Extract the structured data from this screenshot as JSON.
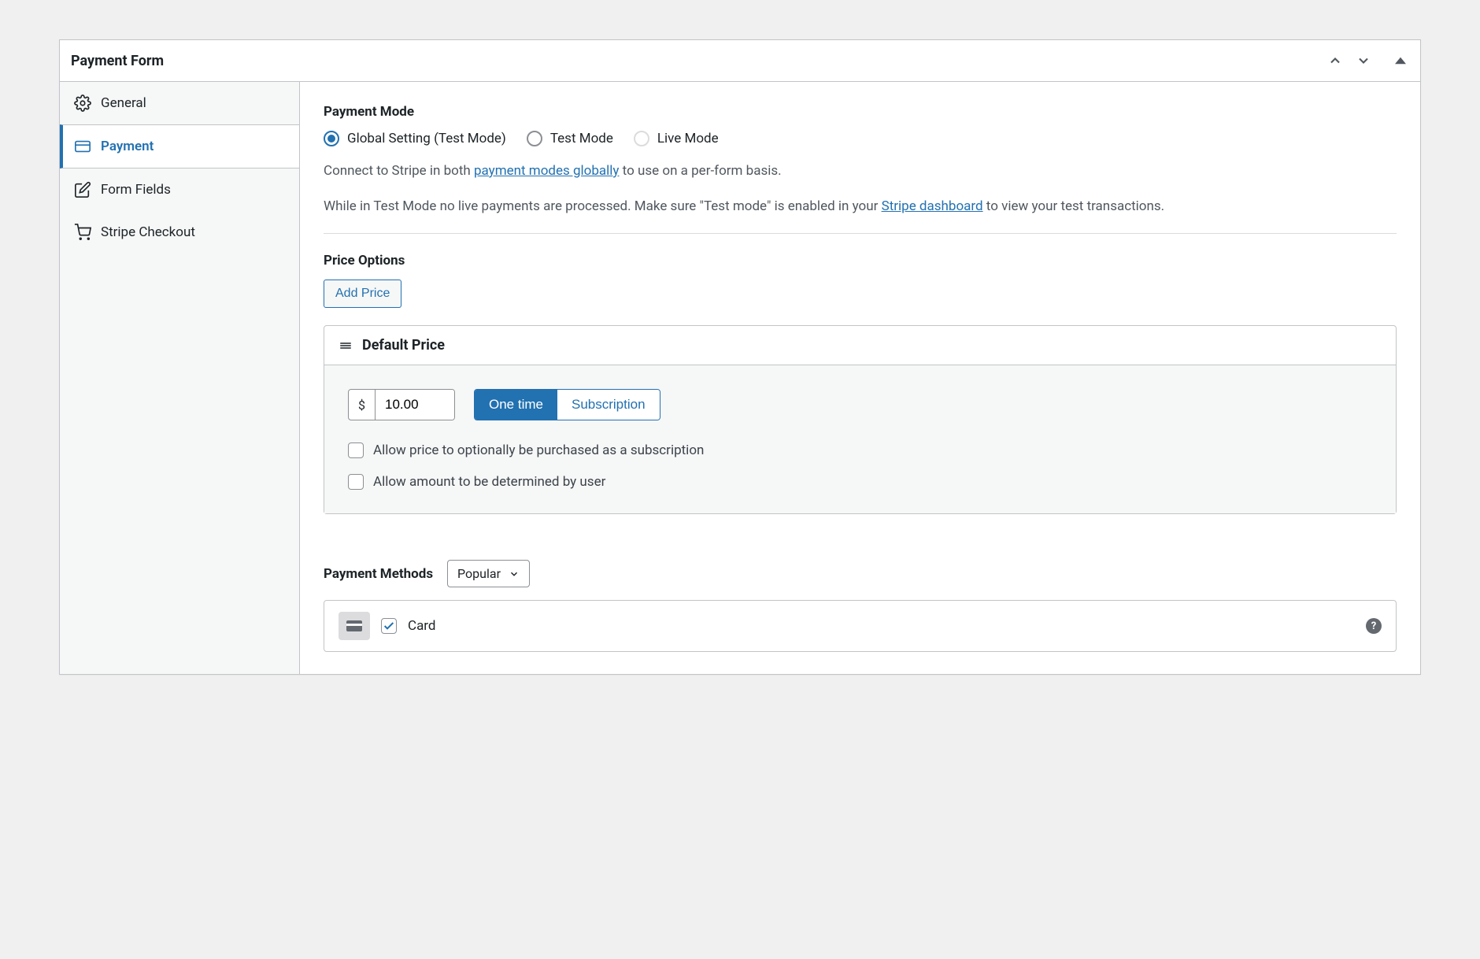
{
  "header": {
    "title": "Payment Form"
  },
  "sidebar": {
    "items": [
      {
        "label": "General"
      },
      {
        "label": "Payment"
      },
      {
        "label": "Form Fields"
      },
      {
        "label": "Stripe Checkout"
      }
    ]
  },
  "payment_mode": {
    "label": "Payment Mode",
    "options": [
      {
        "label": "Global Setting (Test Mode)",
        "selected": true
      },
      {
        "label": "Test Mode",
        "selected": false
      },
      {
        "label": "Live Mode",
        "selected": false,
        "disabled": true
      }
    ],
    "help1_pre": "Connect to Stripe in both ",
    "help1_link": "payment modes globally",
    "help1_post": " to use on a per-form basis.",
    "help2_pre": "While in Test Mode no live payments are processed. Make sure \"Test mode\" is enabled in your ",
    "help2_link": "Stripe dashboard",
    "help2_post": " to view your test transactions."
  },
  "price_options": {
    "label": "Price Options",
    "add_button": "Add Price",
    "card": {
      "title": "Default Price",
      "currency": "$",
      "amount": "10.00",
      "toggle": {
        "one_time": "One time",
        "subscription": "Subscription"
      },
      "checkbox1": "Allow price to optionally be purchased as a subscription",
      "checkbox2": "Allow amount to be determined by user"
    }
  },
  "payment_methods": {
    "label": "Payment Methods",
    "select_value": "Popular",
    "items": [
      {
        "label": "Card",
        "checked": true
      }
    ]
  }
}
